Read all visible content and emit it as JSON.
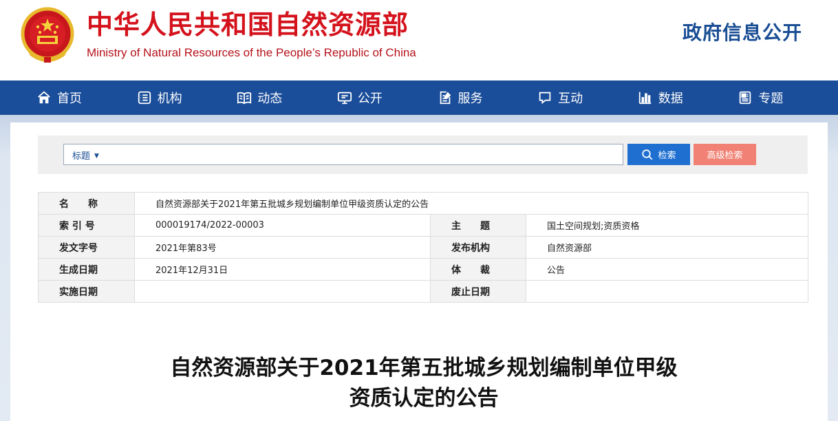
{
  "header": {
    "title": "中华人民共和国自然资源部",
    "subtitle": "Ministry of Natural Resources of the People’s Republic of China",
    "gov_info": "政府信息公开"
  },
  "nav": {
    "items": [
      {
        "label": "首页",
        "icon": "home-icon"
      },
      {
        "label": "机构",
        "icon": "institution-icon"
      },
      {
        "label": "动态",
        "icon": "book-icon"
      },
      {
        "label": "公开",
        "icon": "monitor-icon"
      },
      {
        "label": "服务",
        "icon": "edit-document-icon"
      },
      {
        "label": "互动",
        "icon": "chat-bubble-icon"
      },
      {
        "label": "数据",
        "icon": "bar-chart-icon"
      },
      {
        "label": "专题",
        "icon": "feature-icon"
      }
    ]
  },
  "search": {
    "type_label": "标题",
    "input_value": "",
    "search_button": "检索",
    "advanced_button": "高级检索"
  },
  "info": {
    "name_label": "名　　称",
    "name_value": "自然资源部关于2021年第五批城乡规划编制单位甲级资质认定的公告",
    "index_label": "索 引 号",
    "index_value": "000019174/2022-00003",
    "topic_label": "主　　题",
    "topic_value": "国土空间规划;资质资格",
    "doc_no_label": "发文字号",
    "doc_no_value": "2021年第83号",
    "publisher_label": "发布机构",
    "publisher_value": "自然资源部",
    "gen_date_label": "生成日期",
    "gen_date_value": "2021年12月31日",
    "genre_label": "体　　裁",
    "genre_value": "公告",
    "impl_date_label": "实施日期",
    "impl_date_value": "",
    "expiry_label": "废止日期",
    "expiry_value": ""
  },
  "article": {
    "title_line1": "自然资源部关于2021年第五批城乡规划编制单位甲级",
    "title_line2": "资质认定的公告"
  },
  "colors": {
    "brand_red": "#d4121c",
    "nav_blue": "#1b4e9a",
    "search_blue": "#1f6fd0",
    "advanced_salmon": "#f08174"
  }
}
